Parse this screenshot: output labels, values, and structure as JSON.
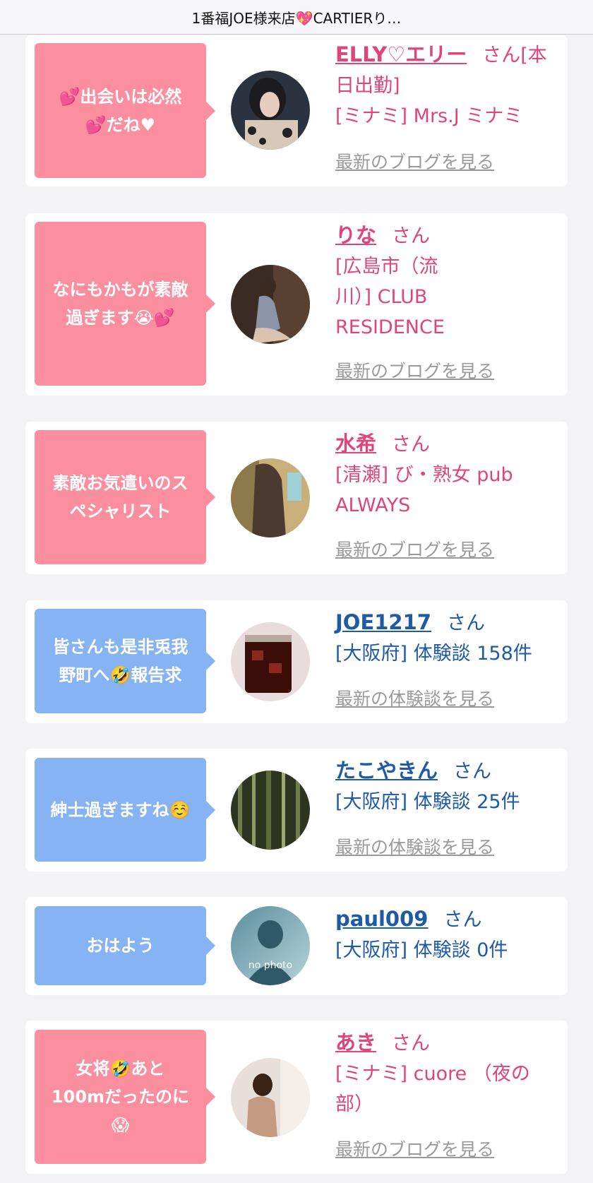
{
  "header": {
    "title": "1番福JOE様来店💖CARTIERり…"
  },
  "san_label": "さん",
  "cards": [
    {
      "comment": [
        "💕出会いは必然",
        "💕だね♥"
      ],
      "name": "ELLY♡エリー",
      "suffix": "さん[本日出勤]",
      "detail": "[ミナミ] Mrs.J ミナミ",
      "more": "最新のブログを見る",
      "theme": "pink",
      "avatar": "woman-portrait"
    },
    {
      "comment": [
        "なにもかもが素敵",
        "過ぎます😭💕"
      ],
      "name": "りな",
      "suffix": "さん",
      "detail": "[広島市（流川）] CLUB RESIDENCE",
      "more": "最新のブログを見る",
      "theme": "pink",
      "avatar": "woman-sitting"
    },
    {
      "comment": [
        "素敵お気遣いのス",
        "ペシャリスト"
      ],
      "name": "水希",
      "suffix": "さん",
      "detail": "[清瀬] び・熟女 pub ALWAYS",
      "more": "最新のブログを見る",
      "theme": "pink",
      "avatar": "long-hair"
    },
    {
      "comment": [
        "皆さんも是非兎我",
        "野町へ🤣報告求"
      ],
      "name": "JOE1217",
      "suffix": "さん",
      "detail": "[大阪府] 体験談 158件",
      "more": "最新の体験談を見る",
      "theme": "blue",
      "avatar": "iced-drink"
    },
    {
      "comment": [
        "紳士過ぎますね☺️"
      ],
      "name": "たこやきん",
      "suffix": "さん",
      "detail": "[大阪府] 体験談 25件",
      "more": "最新の体験談を見る",
      "theme": "blue",
      "avatar": "bamboo-forest"
    },
    {
      "comment": [
        "おはよう"
      ],
      "name": "paul009",
      "suffix": "さん",
      "detail": "[大阪府] 体験談 0件",
      "more": "",
      "theme": "blue",
      "avatar": "no-photo",
      "avatar_text": "no photo"
    },
    {
      "comment": [
        "女将🤣あと",
        "100mだったのに",
        "😱"
      ],
      "name": "あき",
      "suffix": "さん",
      "detail": "[ミナミ] cuore （夜の部）",
      "more": "最新のブログを見る",
      "theme": "pink",
      "avatar": "woman-back"
    }
  ]
}
